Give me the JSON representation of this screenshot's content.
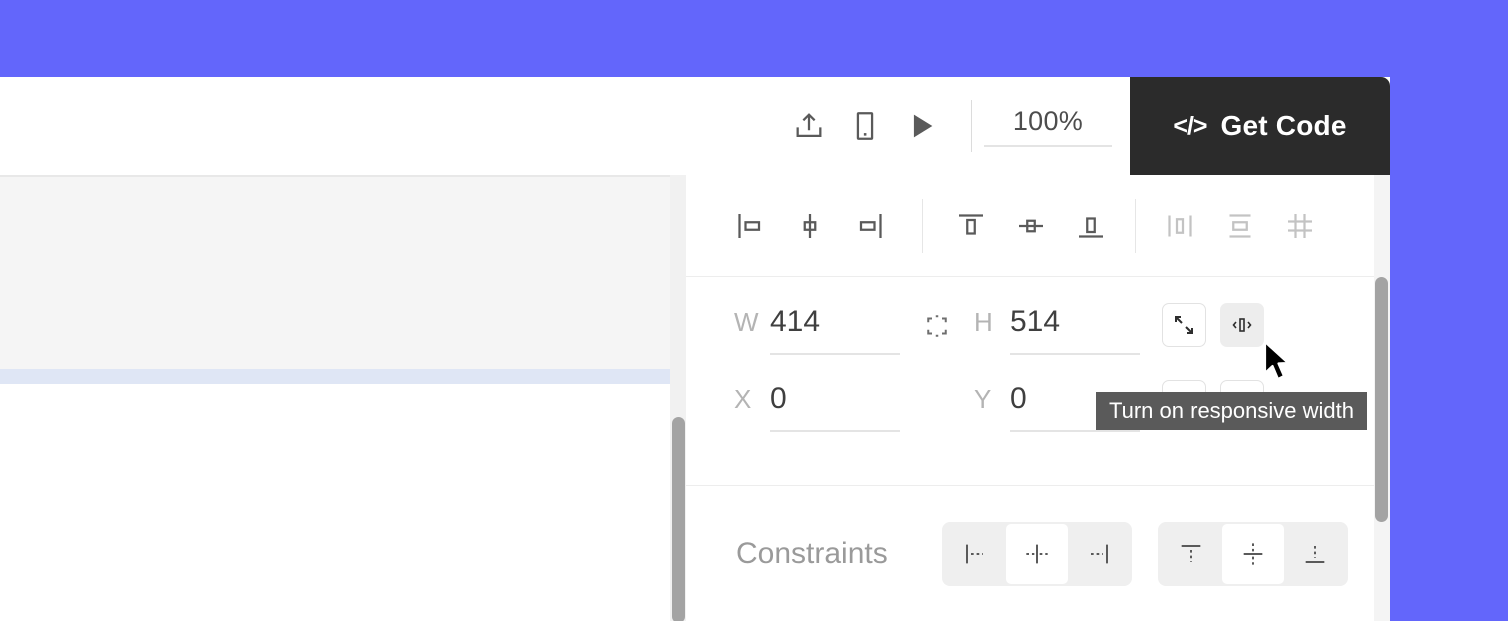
{
  "app": {
    "background_color": "#6366fb",
    "panel_background": "#ffffff"
  },
  "toolbar": {
    "share_icon": "share-upload-icon",
    "device_icon": "mobile-device-icon",
    "preview_icon": "play-preview-icon",
    "zoom_value": "100%",
    "get_code_icon": "</>",
    "get_code_label": "Get Code",
    "get_code_bg": "#2b2b2b"
  },
  "align": {
    "horizontal": [
      {
        "name": "align-left-icon",
        "title": "Align left"
      },
      {
        "name": "align-horizontal-center-icon",
        "title": "Align horizontal center"
      },
      {
        "name": "align-right-icon",
        "title": "Align right"
      }
    ],
    "vertical": [
      {
        "name": "align-top-icon",
        "title": "Align top"
      },
      {
        "name": "align-vertical-center-icon",
        "title": "Align vertical center"
      },
      {
        "name": "align-bottom-icon",
        "title": "Align bottom"
      }
    ],
    "distribute": [
      {
        "name": "distribute-horizontal-icon",
        "title": "Distribute horizontally"
      },
      {
        "name": "distribute-vertical-icon",
        "title": "Distribute vertically"
      },
      {
        "name": "tidy-up-grid-icon",
        "title": "Tidy up"
      }
    ]
  },
  "size": {
    "width_label": "W",
    "width_value": "414",
    "height_label": "H",
    "height_value": "514",
    "x_label": "X",
    "x_value": "0",
    "y_label": "Y",
    "y_value": "0",
    "link_icon": "aspect-ratio-unlinked-icon",
    "fit_button_icon": "expand-fit-icon",
    "responsive_button_icon": "responsive-width-icon",
    "extra_button_icon": "responsive-height-icon"
  },
  "constraints": {
    "label": "Constraints",
    "horizontal": [
      {
        "name": "constraint-left-icon",
        "selected": false
      },
      {
        "name": "constraint-center-horizontal-icon",
        "selected": true
      },
      {
        "name": "constraint-right-icon",
        "selected": false
      }
    ],
    "vertical": [
      {
        "name": "constraint-top-icon",
        "selected": false
      },
      {
        "name": "constraint-center-vertical-icon",
        "selected": true
      },
      {
        "name": "constraint-bottom-icon",
        "selected": false
      }
    ]
  },
  "tooltip": {
    "text": "Turn on responsive width",
    "background": "#5a5a5a"
  },
  "canvas": {
    "block_color": "#f5f5f5",
    "selection_band_color": "#dfe6f5"
  },
  "scrollbars": {
    "canvas_thumb_color": "#a3a3a3",
    "inspector_thumb_color": "#a3a3a3"
  },
  "cursor": {
    "name": "mouse-pointer"
  }
}
